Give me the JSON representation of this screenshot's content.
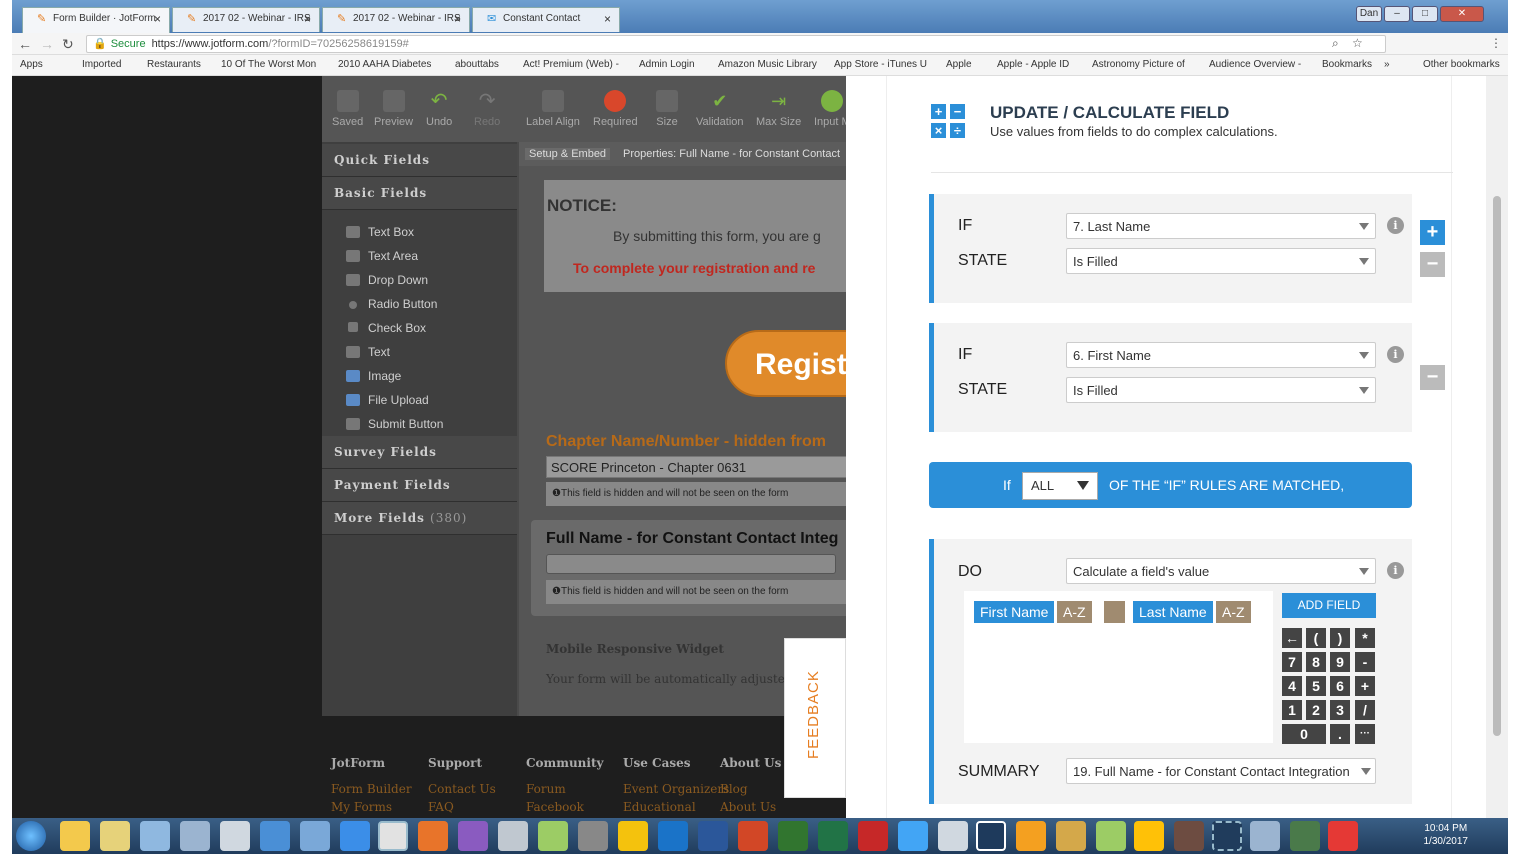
{
  "browser": {
    "tabs": [
      {
        "title": "Form Builder · JotForm",
        "active": true
      },
      {
        "title": "2017 02 - Webinar - IRS",
        "active": false
      },
      {
        "title": "2017 02 - Webinar - IRS",
        "active": false
      },
      {
        "title": "Constant Contact",
        "active": false
      }
    ],
    "user_badge": "Dan",
    "url_secure": "Secure",
    "url_host": "https://www.jotform.com",
    "url_path": "/?formID=70256258619159#",
    "bookmarks": [
      "Apps",
      "Imported",
      "Restaurants",
      "10 Of The Worst Mon",
      "2010 AAHA Diabetes",
      "abouttabs",
      "Act! Premium (Web) -",
      "Admin Login",
      "Amazon Music Library",
      "App Store - iTunes U",
      "Apple",
      "Apple - Apple ID",
      "Astronomy Picture of",
      "Audience Overview -",
      "Bookmarks",
      "»",
      "Other bookmarks"
    ]
  },
  "builder": {
    "toolbar": [
      "Saved",
      "Preview",
      "Undo",
      "Redo",
      "Label Align",
      "Required",
      "Size",
      "Validation",
      "Max Size",
      "Input M"
    ],
    "sections": [
      "Quick Fields",
      "Basic Fields",
      "Survey Fields",
      "Payment Fields",
      "More Fields"
    ],
    "more_count": "(380)",
    "basic_fields": [
      "Text Box",
      "Text Area",
      "Drop Down",
      "Radio Button",
      "Check Box",
      "Text",
      "Image",
      "File Upload",
      "Submit Button"
    ],
    "subtabs": [
      "Setup & Embed",
      "Properties: Full Name - for Constant Contact"
    ],
    "notice_title": "NOTICE:",
    "notice_text": "By submitting this form, you are g",
    "notice_red": "To complete your registration and re",
    "register_btn": "Regist",
    "chapter_label": "Chapter Name/Number - hidden from",
    "chapter_value": "SCORE Princeton - Chapter 0631",
    "hidden_note": "This field is hidden and will not be seen on the form",
    "fullname_label": "Full Name - for Constant Contact Integ",
    "hidden_note2": "This field is hidden and will not be seen on the form",
    "mobile_title": "Mobile Responsive Widget",
    "mobile_text": "Your form will be automatically adjusted to"
  },
  "footer": {
    "cols": [
      {
        "head": "JotForm",
        "links": [
          "Form Builder",
          "My Forms"
        ]
      },
      {
        "head": "Support",
        "links": [
          "Contact Us",
          "FAQ"
        ]
      },
      {
        "head": "Community",
        "links": [
          "Forum",
          "Facebook"
        ]
      },
      {
        "head": "Use Cases",
        "links": [
          "Event Organizers",
          "Educational"
        ]
      },
      {
        "head": "About Us",
        "links": [
          "Blog",
          "About Us"
        ]
      }
    ],
    "feedback": "FEEDBACK"
  },
  "modal": {
    "title": "UPDATE / CALCULATE FIELD",
    "subtitle": "Use values from fields to do complex calculations.",
    "rule1": {
      "if_label": "IF",
      "if_value": "7. Last Name",
      "state_label": "STATE",
      "state_value": "Is Filled"
    },
    "rule2": {
      "if_label": "IF",
      "if_value": "6. First Name",
      "state_label": "STATE",
      "state_value": "Is Filled"
    },
    "match": {
      "prefix": "If",
      "value": "ALL",
      "suffix": "OF THE “IF” RULES ARE MATCHED,"
    },
    "do_label": "DO",
    "do_value": "Calculate a field's value",
    "chips": [
      {
        "label": "First Name",
        "tag": "A-Z"
      },
      {
        "label": "Last Name",
        "tag": "A-Z"
      }
    ],
    "add_field": "ADD FIELD",
    "keypad": [
      "←",
      "(",
      ")",
      "*",
      "7",
      "8",
      "9",
      "-",
      "4",
      "5",
      "6",
      "+",
      "1",
      "2",
      "3",
      "/",
      "0",
      ".",
      "···"
    ],
    "summary_label": "SUMMARY",
    "summary_value": "19. Full Name - for Constant Contact Integration"
  },
  "clock": {
    "time": "10:04 PM",
    "date": "1/30/2017"
  },
  "colors": {
    "accent": "#2b8fd8",
    "orange": "#e67e22"
  }
}
